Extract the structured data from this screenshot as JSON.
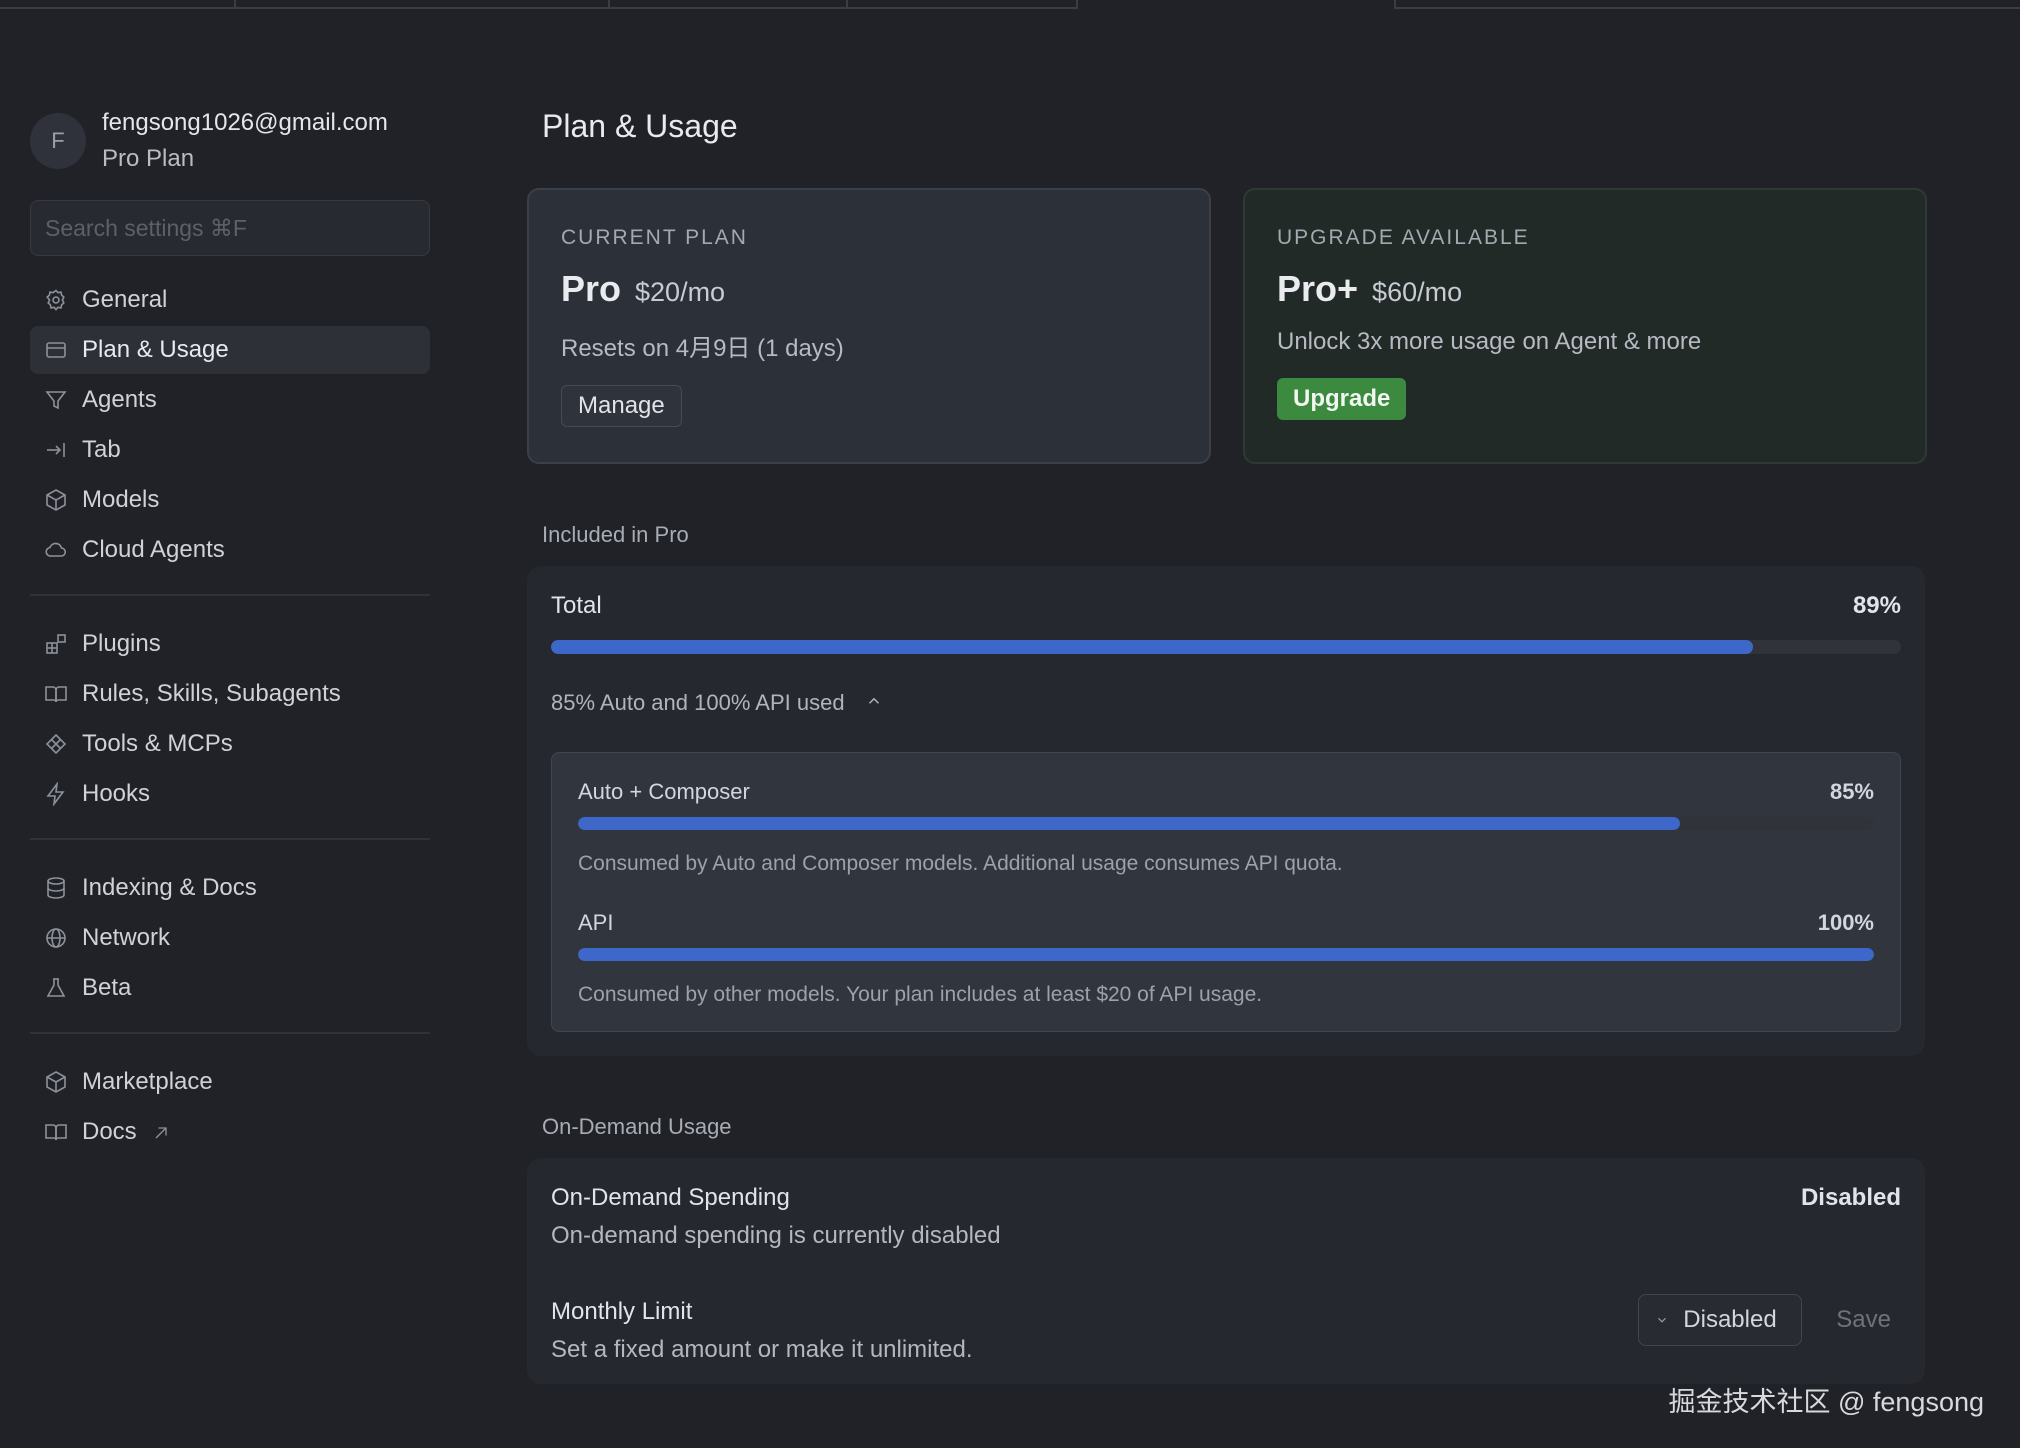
{
  "sidebar": {
    "avatar_initial": "F",
    "email": "fengsong1026@gmail.com",
    "plan": "Pro Plan",
    "search_placeholder": "Search settings ⌘F",
    "items": [
      {
        "label": "General",
        "icon": "gear-icon"
      },
      {
        "label": "Plan & Usage",
        "icon": "card-icon"
      },
      {
        "label": "Agents",
        "icon": "filter-icon"
      },
      {
        "label": "Tab",
        "icon": "tab-arrow-icon"
      },
      {
        "label": "Models",
        "icon": "cube-icon"
      },
      {
        "label": "Cloud Agents",
        "icon": "cloud-icon"
      },
      {
        "label": "Plugins",
        "icon": "plugin-icon"
      },
      {
        "label": "Rules, Skills, Subagents",
        "icon": "book-icon"
      },
      {
        "label": "Tools & MCPs",
        "icon": "tools-icon"
      },
      {
        "label": "Hooks",
        "icon": "bolt-icon"
      },
      {
        "label": "Indexing & Docs",
        "icon": "database-icon"
      },
      {
        "label": "Network",
        "icon": "globe-icon"
      },
      {
        "label": "Beta",
        "icon": "flask-icon"
      },
      {
        "label": "Marketplace",
        "icon": "package-icon"
      },
      {
        "label": "Docs",
        "icon": "book-open-icon"
      }
    ]
  },
  "main": {
    "title": "Plan & Usage",
    "current_plan": {
      "kicker": "CURRENT PLAN",
      "name": "Pro",
      "price": "$20/mo",
      "desc": "Resets on 4月9日 (1 days)",
      "button": "Manage"
    },
    "upgrade_plan": {
      "kicker": "UPGRADE AVAILABLE",
      "name": "Pro+",
      "price": "$60/mo",
      "desc": "Unlock 3x more usage on Agent & more",
      "button": "Upgrade"
    },
    "included_label": "Included in Pro",
    "total": {
      "label": "Total",
      "pct_text": "89%",
      "pct": 89
    },
    "breakdown_toggle": "85% Auto and 100% API used",
    "breakdown": [
      {
        "label": "Auto + Composer",
        "pct_text": "85%",
        "pct": 85,
        "desc": "Consumed by Auto and Composer models. Additional usage consumes API quota."
      },
      {
        "label": "API",
        "pct_text": "100%",
        "pct": 100,
        "desc": "Consumed by other models. Your plan includes at least $20 of API usage."
      }
    ],
    "on_demand_label": "On-Demand Usage",
    "on_demand": {
      "spending_title": "On-Demand Spending",
      "spending_sub": "On-demand spending is currently disabled",
      "spending_status": "Disabled",
      "limit_title": "Monthly Limit",
      "limit_sub": "Set a fixed amount or make it unlimited.",
      "limit_select": "Disabled",
      "save": "Save"
    }
  },
  "colors": {
    "accent_blue": "#3d67c9",
    "upgrade_green": "#3c8a3f",
    "background": "#202227"
  },
  "watermark": "掘金技术社区 @ fengsong"
}
